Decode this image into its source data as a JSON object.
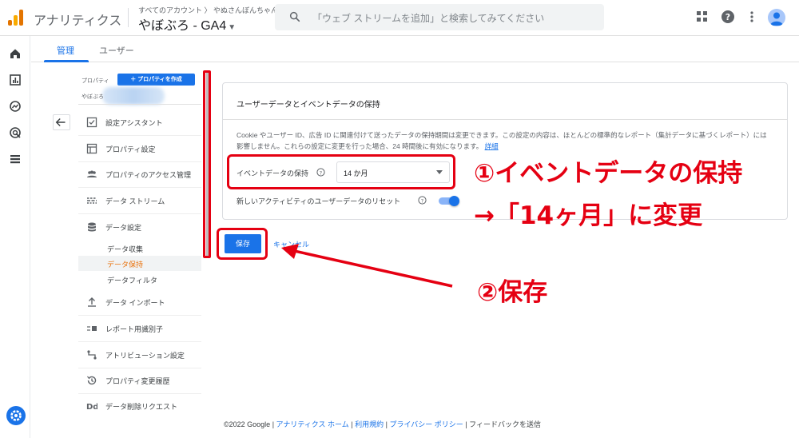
{
  "topbar": {
    "app_name": "アナリティクス",
    "breadcrumb": "すべてのアカウント 〉 やぬさんぼんちゃん",
    "property": "やぼぶろ - GA4",
    "search_placeholder": "「ウェブ ストリームを追加」と検索してみてください",
    "icons": [
      "apps-icon",
      "help-icon",
      "more-vert-icon",
      "account-avatar"
    ]
  },
  "rail": {
    "icons": [
      "home-icon",
      "reports-icon",
      "explore-icon",
      "advertising-icon",
      "configure-icon",
      "settings-icon"
    ]
  },
  "tabs": [
    {
      "label": "管理",
      "active": true
    },
    {
      "label": "ユーザー",
      "active": false
    }
  ],
  "admin_panel": {
    "property_label": "プロパティ",
    "create_button": "＋ プロパティを作成",
    "property_value": "やぼぶろ",
    "nav": [
      {
        "label": "設定アシスタント",
        "icon": "checklist-icon"
      },
      {
        "label": "プロパティ設定",
        "icon": "layout-icon"
      },
      {
        "label": "プロパティのアクセス管理",
        "icon": "people-icon"
      },
      {
        "label": "データ ストリーム",
        "icon": "stream-icon"
      },
      {
        "label": "データ設定",
        "icon": "database-icon"
      }
    ],
    "subnav": [
      {
        "label": "データ収集",
        "active": false
      },
      {
        "label": "データ保持",
        "active": true
      },
      {
        "label": "データフィルタ",
        "active": false
      }
    ],
    "nav2": [
      {
        "label": "データ インポート",
        "icon": "upload-icon"
      },
      {
        "label": "レポート用識別子",
        "icon": "identity-icon"
      },
      {
        "label": "アトリビューション設定",
        "icon": "attribution-icon"
      },
      {
        "label": "プロパティ変更履歴",
        "icon": "history-icon"
      },
      {
        "label": "データ削除リクエスト",
        "icon": "dd-icon"
      }
    ]
  },
  "card": {
    "title": "ユーザーデータとイベントデータの保持",
    "description": "Cookie やユーザー ID、広告 ID に関連付けて送ったデータの保持期間は変更できます。この設定の内容は、ほとんどの標準的なレポート（集計データに基づくレポート）には影響しません。これらの設定に変更を行った場合、24 時間後に有効になります。",
    "detail_link": "詳細",
    "event_retention_label": "イベントデータの保持",
    "event_retention_value": "14 か月",
    "reset_label": "新しいアクティビティのユーザーデータのリセット",
    "reset_enabled": true
  },
  "actions": {
    "save": "保存",
    "cancel": "キャンセル"
  },
  "annotations": {
    "step1": "①イベントデータの保持",
    "step1b": "→「14ヶ月」に変更",
    "step2": "②保存",
    "color": "#e50012"
  },
  "footer": {
    "copyright": "©2022 Google",
    "home": "アナリティクス ホーム",
    "terms": "利用規約",
    "privacy": "プライバシー ポリシー",
    "feedback": "フィードバックを送信"
  }
}
